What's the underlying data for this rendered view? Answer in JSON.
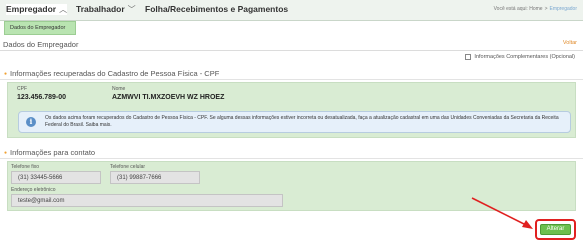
{
  "nav": {
    "items": [
      {
        "label": "Empregador"
      },
      {
        "label": "Trabalhador"
      },
      {
        "label": "Folha/Recebimentos e Pagamentos"
      }
    ],
    "breadcrumb": {
      "prefix": "Você está aqui:",
      "home": "Home",
      "current": "Empregador"
    }
  },
  "submenu": {
    "label": "Dados do Empregador"
  },
  "page": {
    "title": "Dados do Empregador",
    "back_label": "Voltar"
  },
  "extra_info": {
    "label": "Informações Complementares (Opcional)"
  },
  "cpf_section": {
    "title": "Informações recuperadas do Cadastro de Pessoa Física - CPF",
    "cpf_label": "CPF",
    "cpf_value": "123.456.789-00",
    "name_label": "Nome",
    "name_value": "AZMWVI TI.MXZOEVH WZ HROEZ",
    "notice": "Os dados acima foram recuperados do Cadastro de Pessoa Física - CPF. Se alguma dessas informações estiver incorreta ou desatualizada, faça a atualização cadastral em uma das Unidades Conveniadas da Secretaria da Receita Federal do Brasil. Saiba mais."
  },
  "contact_section": {
    "title": "Informações para contato",
    "landline_label": "Telefone fixo",
    "landline_value": "(31) 33445-5666",
    "mobile_label": "Telefone celular",
    "mobile_value": "(31) 99887-7666",
    "email_label": "Endereço eletrônico",
    "email_value": "teste@gmail.com"
  },
  "actions": {
    "alter_label": "Alterar"
  },
  "colors": {
    "accent_green": "#6cbf4e",
    "highlight_red": "#e02020",
    "panel_green": "#d9ecd3",
    "voltar_orange": "#e08a2a"
  },
  "icons": [
    "chevron-up-icon",
    "chevron-down-icon",
    "info-icon",
    "arrow-annotation"
  ]
}
